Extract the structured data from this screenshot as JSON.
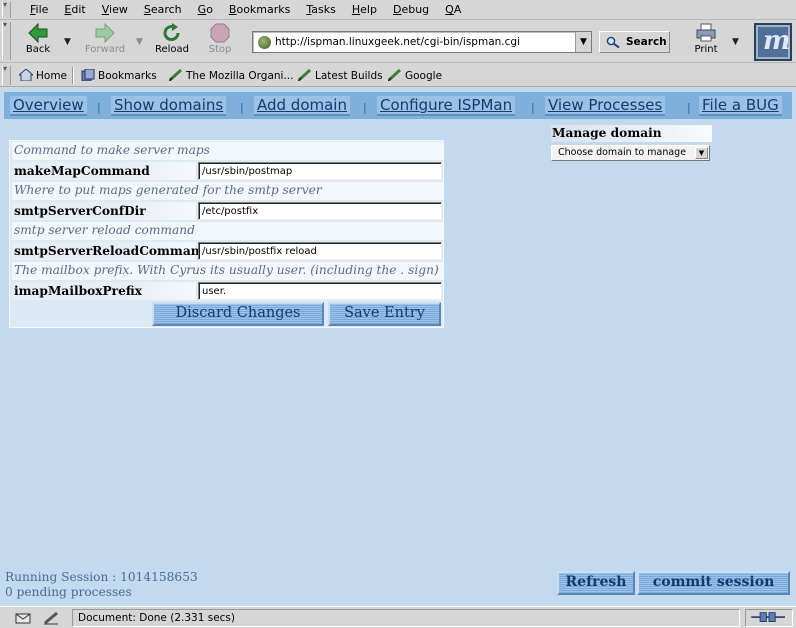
{
  "menubar": {
    "items": [
      "File",
      "Edit",
      "View",
      "Search",
      "Go",
      "Bookmarks",
      "Tasks",
      "Help",
      "Debug",
      "QA"
    ]
  },
  "navbar": {
    "back_label": "Back",
    "forward_label": "Forward",
    "reload_label": "Reload",
    "stop_label": "Stop",
    "url": "http://ispman.linuxgeek.net/cgi-bin/ispman.cgi",
    "search_label": "Search",
    "print_label": "Print"
  },
  "personal_toolbar": {
    "items": [
      "Home",
      "Bookmarks",
      "The Mozilla Organi...",
      "Latest Builds",
      "Google"
    ]
  },
  "page": {
    "nav": [
      "Overview",
      "Show domains",
      "Add domain",
      "Configure ISPMan",
      "View Processes",
      "File a BUG"
    ],
    "nav_separator": "|",
    "config": [
      {
        "description": "Command to make server maps",
        "label": "makeMapCommand",
        "value": "/usr/sbin/postmap"
      },
      {
        "description": "Where to put maps generated for the smtp server",
        "label": "smtpServerConfDir",
        "value": "/etc/postfix"
      },
      {
        "description": "smtp server reload command",
        "label": "smtpServerReloadCommand",
        "value": "/usr/sbin/postfix reload"
      },
      {
        "description": "The mailbox prefix. With Cyrus its usually user. (including the . sign)",
        "label": "imapMailboxPrefix",
        "value": "user."
      }
    ],
    "discard_label": "Discard Changes",
    "save_label": "Save Entry",
    "manage": {
      "title": "Manage domain",
      "select_value": "Choose domain to manage"
    },
    "session": {
      "running": "Running Session : 1014158653",
      "pending": "0 pending processes"
    },
    "refresh_label": "Refresh",
    "commit_label": "commit session"
  },
  "statusbar": {
    "text": "Document: Done (2.331 secs)"
  },
  "colors": {
    "page_background": "#c3d9ee",
    "nav_bar": "#7fb0dc",
    "link_text": "#143a70",
    "description_text": "#5b6a86"
  }
}
